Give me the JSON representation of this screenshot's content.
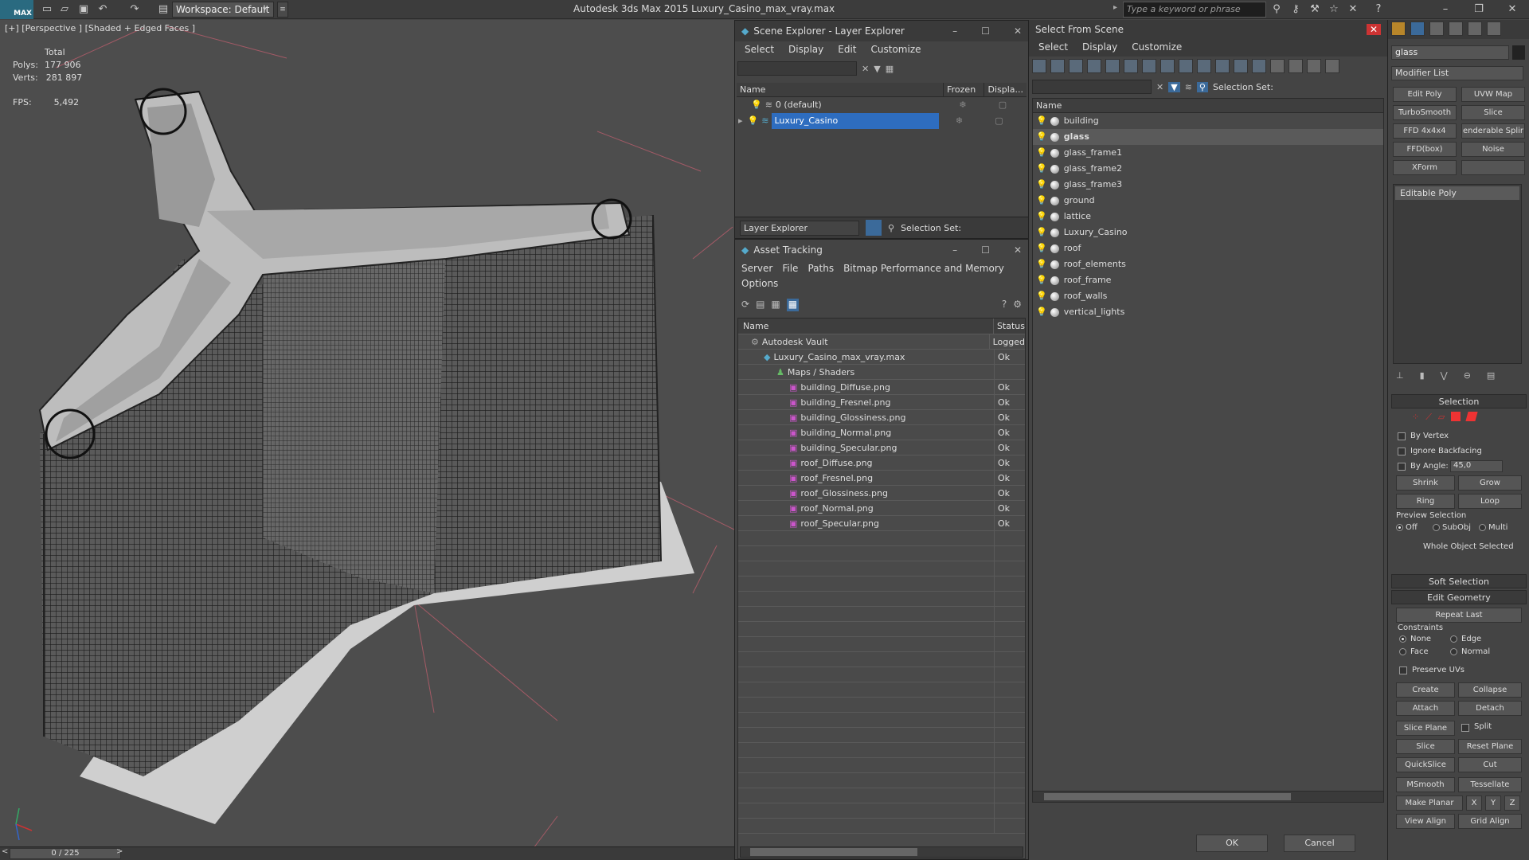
{
  "app": {
    "logo_label": "MAX",
    "title": "Autodesk 3ds Max  2015    Luxury_Casino_max_vray.max",
    "workspace": "Workspace: Default",
    "search_placeholder": "Type a keyword or phrase",
    "icons": [
      "new-file-icon",
      "open-icon",
      "save-icon",
      "undo-icon",
      "redo-icon",
      "project-icon"
    ]
  },
  "viewport": {
    "label": "[+] [Perspective ] [Shaded + Edged Faces ]",
    "stats": {
      "total_label": "Total",
      "polys_label": "Polys:",
      "polys": "177 906",
      "verts_label": "Verts:",
      "verts": "281 897",
      "fps_label": "FPS:",
      "fps": "5,492"
    },
    "time_slider": "0 / 225",
    "slider_prev": "<",
    "slider_next": ">"
  },
  "scene_explorer": {
    "title": "Scene Explorer - Layer Explorer",
    "menu": [
      "Select",
      "Display",
      "Edit",
      "Customize"
    ],
    "columns": {
      "name": "Name",
      "frozen": "Frozen",
      "display": "Displa..."
    },
    "layers": [
      {
        "name": "0 (default)",
        "selected": false
      },
      {
        "name": "Luxury_Casino",
        "selected": true
      }
    ],
    "footer_dropdown": "Layer Explorer",
    "selection_set_label": "Selection Set:"
  },
  "asset_tracking": {
    "title": "Asset Tracking",
    "menu": [
      "Server",
      "File",
      "Paths",
      "Bitmap Performance and Memory"
    ],
    "menu2": [
      "Options"
    ],
    "columns": {
      "name": "Name",
      "status": "Status"
    },
    "rows": [
      {
        "name": "Autodesk Vault",
        "status": "Logged",
        "indent": 1
      },
      {
        "name": "Luxury_Casino_max_vray.max",
        "status": "Ok",
        "indent": 2
      },
      {
        "name": "Maps / Shaders",
        "status": "",
        "indent": 3
      },
      {
        "name": "building_Diffuse.png",
        "status": "Ok",
        "indent": 4
      },
      {
        "name": "building_Fresnel.png",
        "status": "Ok",
        "indent": 4
      },
      {
        "name": "building_Glossiness.png",
        "status": "Ok",
        "indent": 4
      },
      {
        "name": "building_Normal.png",
        "status": "Ok",
        "indent": 4
      },
      {
        "name": "building_Specular.png",
        "status": "Ok",
        "indent": 4
      },
      {
        "name": "roof_Diffuse.png",
        "status": "Ok",
        "indent": 4
      },
      {
        "name": "roof_Fresnel.png",
        "status": "Ok",
        "indent": 4
      },
      {
        "name": "roof_Glossiness.png",
        "status": "Ok",
        "indent": 4
      },
      {
        "name": "roof_Normal.png",
        "status": "Ok",
        "indent": 4
      },
      {
        "name": "roof_Specular.png",
        "status": "Ok",
        "indent": 4
      }
    ]
  },
  "select_from_scene": {
    "title": "Select From Scene",
    "menu": [
      "Select",
      "Display",
      "Customize"
    ],
    "selection_set_label": "Selection Set:",
    "column_name": "Name",
    "objects": [
      {
        "name": "building",
        "selected": false
      },
      {
        "name": "glass",
        "selected": true
      },
      {
        "name": "glass_frame1",
        "selected": false
      },
      {
        "name": "glass_frame2",
        "selected": false
      },
      {
        "name": "glass_frame3",
        "selected": false
      },
      {
        "name": "ground",
        "selected": false
      },
      {
        "name": "lattice",
        "selected": false
      },
      {
        "name": "Luxury_Casino",
        "selected": false
      },
      {
        "name": "roof",
        "selected": false
      },
      {
        "name": "roof_elements",
        "selected": false
      },
      {
        "name": "roof_frame",
        "selected": false
      },
      {
        "name": "roof_walls",
        "selected": false
      },
      {
        "name": "vertical_lights",
        "selected": false
      }
    ],
    "ok": "OK",
    "cancel": "Cancel"
  },
  "command_panel": {
    "object_name": "glass",
    "modifier_list": "Modifier List",
    "modifier_buttons": [
      "Edit Poly",
      "UVW Map",
      "TurboSmooth",
      "Slice",
      "FFD 4x4x4",
      "enderable Splir",
      "FFD(box)",
      "Noise",
      "XForm",
      ""
    ],
    "stack_item": "Editable Poly",
    "selection": {
      "title": "Selection",
      "by_vertex": "By Vertex",
      "ignore_backfacing": "Ignore Backfacing",
      "by_angle": "By Angle:",
      "angle_value": "45,0",
      "shrink": "Shrink",
      "grow": "Grow",
      "ring": "Ring",
      "loop": "Loop",
      "preview_selection": "Preview Selection",
      "preview_off": "Off",
      "preview_subobj": "SubObj",
      "preview_multi": "Multi",
      "status": "Whole Object Selected"
    },
    "soft_selection": "Soft Selection",
    "edit_geometry": {
      "title": "Edit Geometry",
      "repeat_last": "Repeat Last",
      "constraints": "Constraints",
      "none": "None",
      "edge": "Edge",
      "face": "Face",
      "normal": "Normal",
      "preserve_uvs": "Preserve UVs",
      "create": "Create",
      "collapse": "Collapse",
      "attach": "Attach",
      "detach": "Detach",
      "slice_plane": "Slice Plane",
      "split": "Split",
      "slice": "Slice",
      "reset_plane": "Reset Plane",
      "quickslice": "QuickSlice",
      "cut": "Cut",
      "msmooth": "MSmooth",
      "tessellate": "Tessellate",
      "make_planar": "Make Planar",
      "x": "X",
      "y": "Y",
      "z": "Z",
      "view_align": "View Align",
      "grid_align": "Grid Align"
    }
  }
}
